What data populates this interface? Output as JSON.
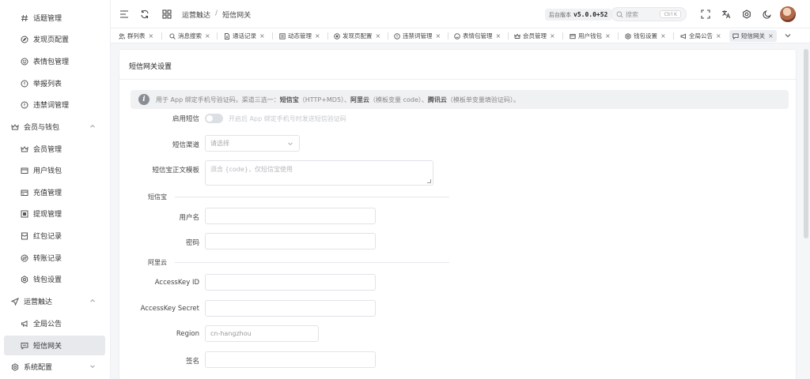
{
  "sidebar": {
    "items": [
      {
        "label": "话题管理",
        "icon": "hash-icon"
      },
      {
        "label": "发现页配置",
        "icon": "compass-icon"
      },
      {
        "label": "表情包管理",
        "icon": "smile-icon"
      },
      {
        "label": "举报列表",
        "icon": "alert-icon"
      },
      {
        "label": "违禁词管理",
        "icon": "alert-icon"
      },
      {
        "label": "会员与钱包",
        "icon": "crown-icon"
      },
      {
        "label": "会员管理",
        "icon": "crown-icon"
      },
      {
        "label": "用户钱包",
        "icon": "wallet-icon"
      },
      {
        "label": "充值管理",
        "icon": "card-icon"
      },
      {
        "label": "提现管理",
        "icon": "withdraw-icon"
      },
      {
        "label": "红包记录",
        "icon": "redpacket-icon"
      },
      {
        "label": "转账记录",
        "icon": "transfer-icon"
      },
      {
        "label": "钱包设置",
        "icon": "gear-icon"
      },
      {
        "label": "运营触达",
        "icon": "send-icon"
      },
      {
        "label": "全局公告",
        "icon": "megaphone-icon"
      },
      {
        "label": "短信网关",
        "icon": "message-icon"
      },
      {
        "label": "系统配置",
        "icon": "gear-icon"
      }
    ]
  },
  "header": {
    "breadcrumb": [
      "运营触达",
      "短信网关"
    ],
    "version_label": "后台版本",
    "version": "v5.0.0+52",
    "search_placeholder": "搜索",
    "search_shortcut": "Ctrl K"
  },
  "tabs": [
    {
      "label": "群列表",
      "icon": "users-icon"
    },
    {
      "label": "消息搜索",
      "icon": "search-icon"
    },
    {
      "label": "通话记录",
      "icon": "document-icon"
    },
    {
      "label": "动态管理",
      "icon": "list-icon"
    },
    {
      "label": "发现页配置",
      "icon": "compass-icon"
    },
    {
      "label": "违禁词管理",
      "icon": "alert-icon"
    },
    {
      "label": "表情包管理",
      "icon": "smile-icon"
    },
    {
      "label": "会员管理",
      "icon": "crown-icon"
    },
    {
      "label": "用户钱包",
      "icon": "wallet-icon"
    },
    {
      "label": "钱包设置",
      "icon": "gear-icon"
    },
    {
      "label": "全局公告",
      "icon": "megaphone-icon"
    },
    {
      "label": "短信网关",
      "icon": "message-icon"
    }
  ],
  "page": {
    "title": "短信网关设置",
    "notice": {
      "prefix": "用于 App 绑定手机号验证码。渠道三选一：",
      "opt1": "短信宝",
      "opt1_note": "（HTTP+MD5）、",
      "opt2": "阿里云",
      "opt2_note": "（模板变量 code）、",
      "opt3": "腾讯云",
      "opt3_note": "（模板单变量填验证码）。"
    },
    "form": {
      "enable_label": "启用短信",
      "enable_hint": "开启后 App 绑定手机号时发送短信验证码",
      "channel_label": "短信渠道",
      "channel_placeholder": "请选择",
      "template_label": "短信宝正文模板",
      "template_placeholder": "须含 {code}，仅短信宝使用",
      "section_dxb": "短信宝",
      "username_label": "用户名",
      "password_label": "密码",
      "section_aliyun": "阿里云",
      "akid_label": "AccessKey ID",
      "aksecret_label": "AccessKey Secret",
      "region_label": "Region",
      "region_value": "cn-hangzhou",
      "sign_label": "签名"
    }
  }
}
